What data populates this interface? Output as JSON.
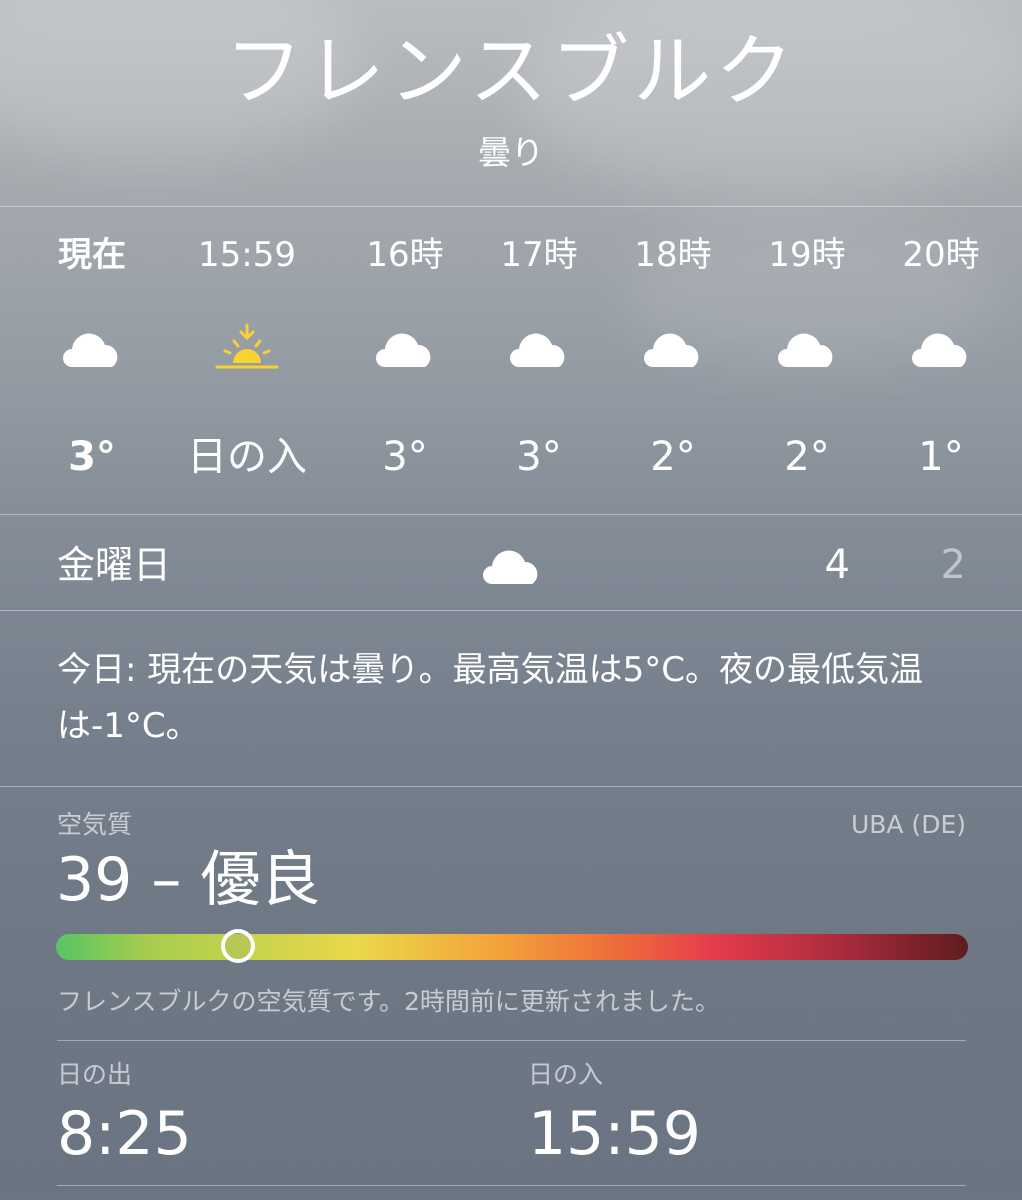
{
  "city": "フレンスブルク",
  "condition": "曇り",
  "hourly": [
    {
      "time": "現在",
      "icon": "cloud-icon",
      "temp": "3°",
      "bold": true
    },
    {
      "time": "15:59",
      "icon": "sunset-icon",
      "temp": "日の入",
      "bold": false
    },
    {
      "time": "16時",
      "icon": "cloud-icon",
      "temp": "3°",
      "bold": false
    },
    {
      "time": "17時",
      "icon": "cloud-icon",
      "temp": "3°",
      "bold": false
    },
    {
      "time": "18時",
      "icon": "cloud-icon",
      "temp": "2°",
      "bold": false
    },
    {
      "time": "19時",
      "icon": "cloud-icon",
      "temp": "2°",
      "bold": false
    },
    {
      "time": "20時",
      "icon": "cloud-icon",
      "temp": "1°",
      "bold": false
    }
  ],
  "daily": {
    "day": "金曜日",
    "icon": "cloud-icon",
    "high": "4",
    "low": "2"
  },
  "summary": "今日: 現在の天気は曇り。最高気温は5°C。夜の最低気温は-1°C。",
  "air_quality": {
    "label": "空気質",
    "source": "UBA (DE)",
    "value": "39 – 優良",
    "level_fraction": 0.2,
    "note": "フレンスブルクの空気質です。2時間前に更新されました。"
  },
  "sun": {
    "sunrise_label": "日の出",
    "sunrise_time": "8:25",
    "sunset_label": "日の入",
    "sunset_time": "15:59"
  },
  "colors": {
    "sun_yellow": "#f7d232",
    "cloud": "#ffffff"
  }
}
